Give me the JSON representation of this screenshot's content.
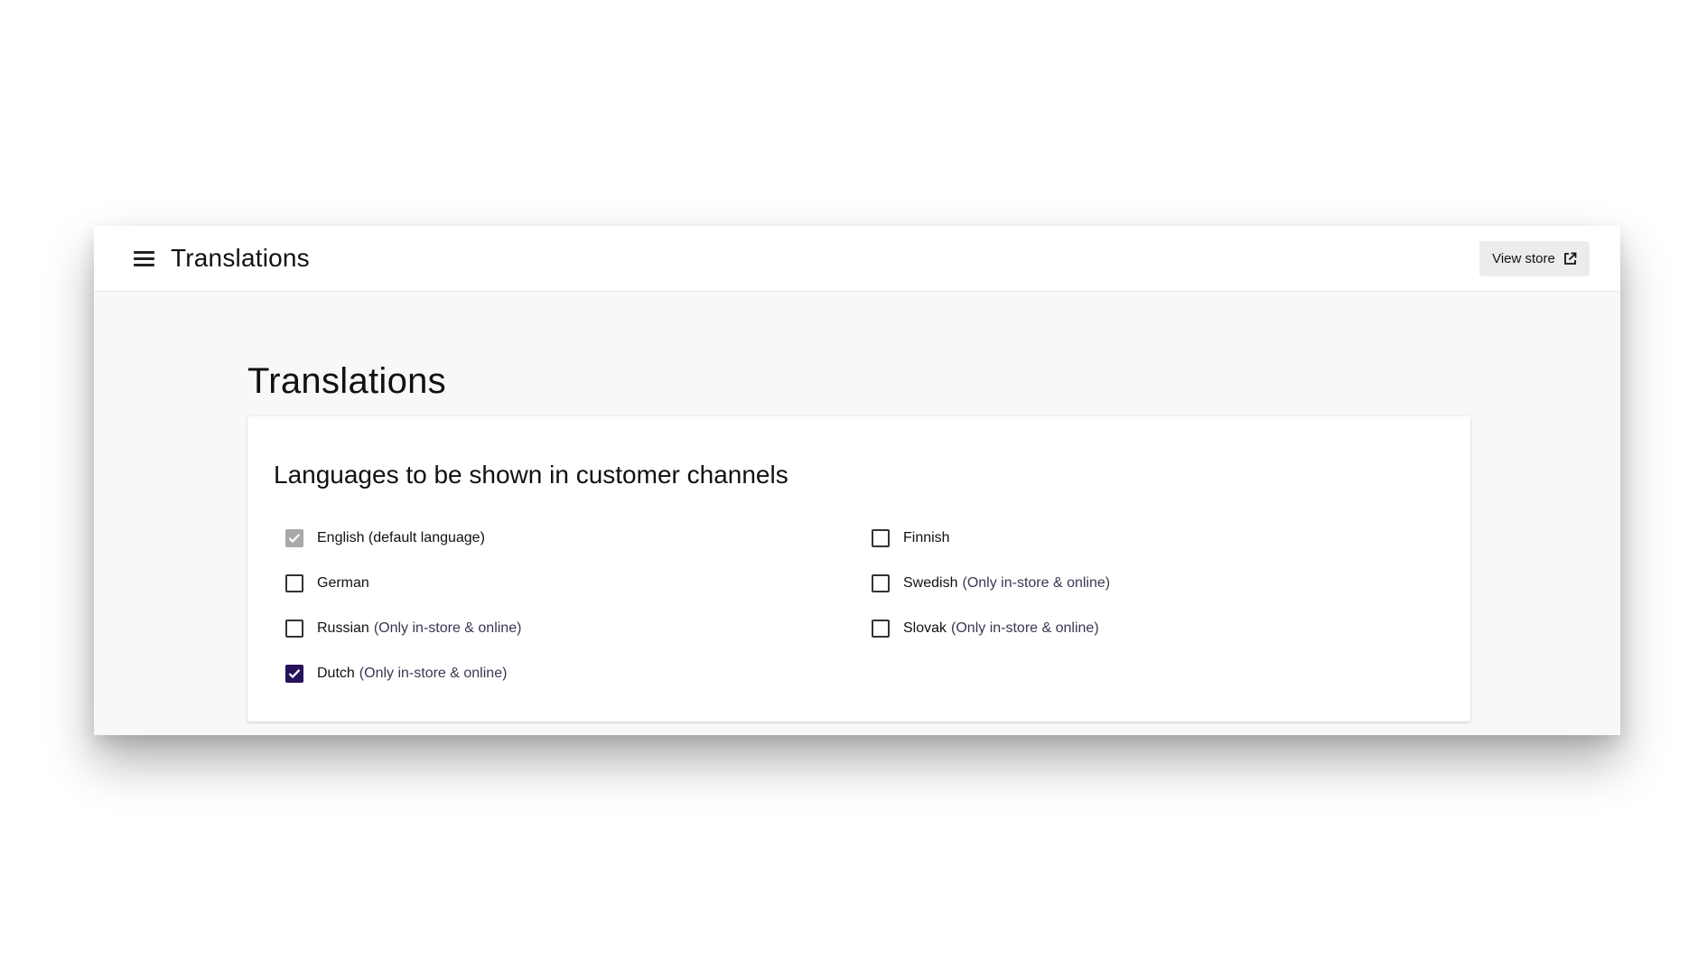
{
  "topbar": {
    "title": "Translations",
    "view_store_label": "View store",
    "menu_icon": "hamburger-menu-icon",
    "external_icon": "external-link-icon"
  },
  "page": {
    "title": "Translations"
  },
  "languages_card": {
    "title": "Languages to be shown in customer channels",
    "note_text": "(Only in-store & online)",
    "options": [
      {
        "label": "English (default language)",
        "checked": true,
        "disabled": true,
        "note": false
      },
      {
        "label": "German",
        "checked": false,
        "disabled": false,
        "note": false
      },
      {
        "label": "Russian",
        "checked": false,
        "disabled": false,
        "note": true
      },
      {
        "label": "Dutch",
        "checked": true,
        "disabled": false,
        "note": true
      },
      {
        "label": "Finnish",
        "checked": false,
        "disabled": false,
        "note": false
      },
      {
        "label": "Swedish",
        "checked": false,
        "disabled": false,
        "note": true
      },
      {
        "label": "Slovak",
        "checked": false,
        "disabled": false,
        "note": true
      }
    ]
  },
  "colors": {
    "accent_checked": "#26115b",
    "disabled_checked": "#a8a8ab",
    "note_text": "#3a3752",
    "button_bg": "#ececec"
  }
}
